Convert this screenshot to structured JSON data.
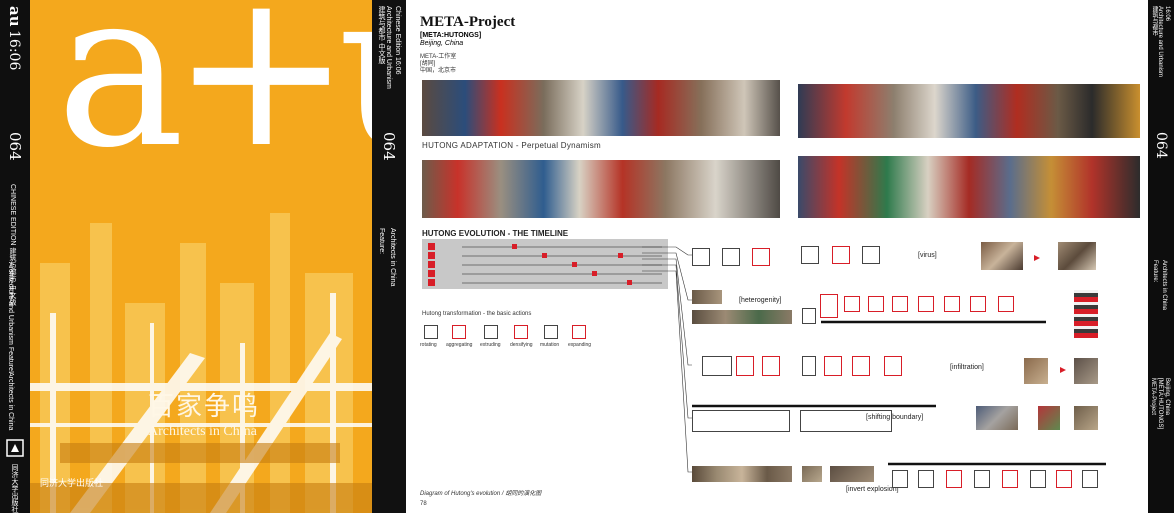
{
  "spine_left": {
    "logo": "au",
    "issue": "16:06",
    "number": "064",
    "lines": [
      "CHINESE EDITION 建筑与都市 中文版",
      "Architecture and Urbanism Feature!",
      "Architects in China"
    ]
  },
  "cover": {
    "logo": "a+u",
    "title_zh": "百家争鸣",
    "title_en": "Architects in China",
    "publisher": "同济大学出版社"
  },
  "spine_mid": {
    "header": "建筑与都市 中文版",
    "line1": "Architecture and Urbanism",
    "line2": "Chinese Edition 16:06",
    "number": "064",
    "feature": "Feature:",
    "feature_title": "Architects in China"
  },
  "page": {
    "title": "META-Project",
    "subtitle": "[META:HUTONGS]",
    "location": "Beijing, China",
    "zh_name": "META-工作室",
    "zh_project": "[胡同]",
    "zh_location": "中国，北京市",
    "section1": "HUTONG ADAPTATION - Perpetual Dynamism",
    "section2": "HUTONG EVOLUTION - THE TIMELINE",
    "basic_actions": "Hutong transformation - the basic actions",
    "actions": [
      "rotating",
      "aggregating",
      "extruding",
      "densifying",
      "mutation",
      "expanding"
    ],
    "labels": [
      "[virus]",
      "[heterogenity]",
      "[infiltration]",
      "[shifting boundary]",
      "[invert explosion]"
    ],
    "caption": "Diagram of Hutong's evolution / 胡同的演化图",
    "page_number": "78"
  },
  "spine_right": {
    "header": "建筑与都市",
    "line1": "Architecture and Urbanism",
    "line2": "16:06",
    "number": "064",
    "feature": "Feature:",
    "feature_title": "Architects in China",
    "project": "META-Project",
    "project_sub": "[META:HUTONGS]",
    "project_loc": "Beijing, China"
  },
  "colors": {
    "cover": "#f4a81d",
    "accent": "#d81e28",
    "spine": "#111111"
  }
}
